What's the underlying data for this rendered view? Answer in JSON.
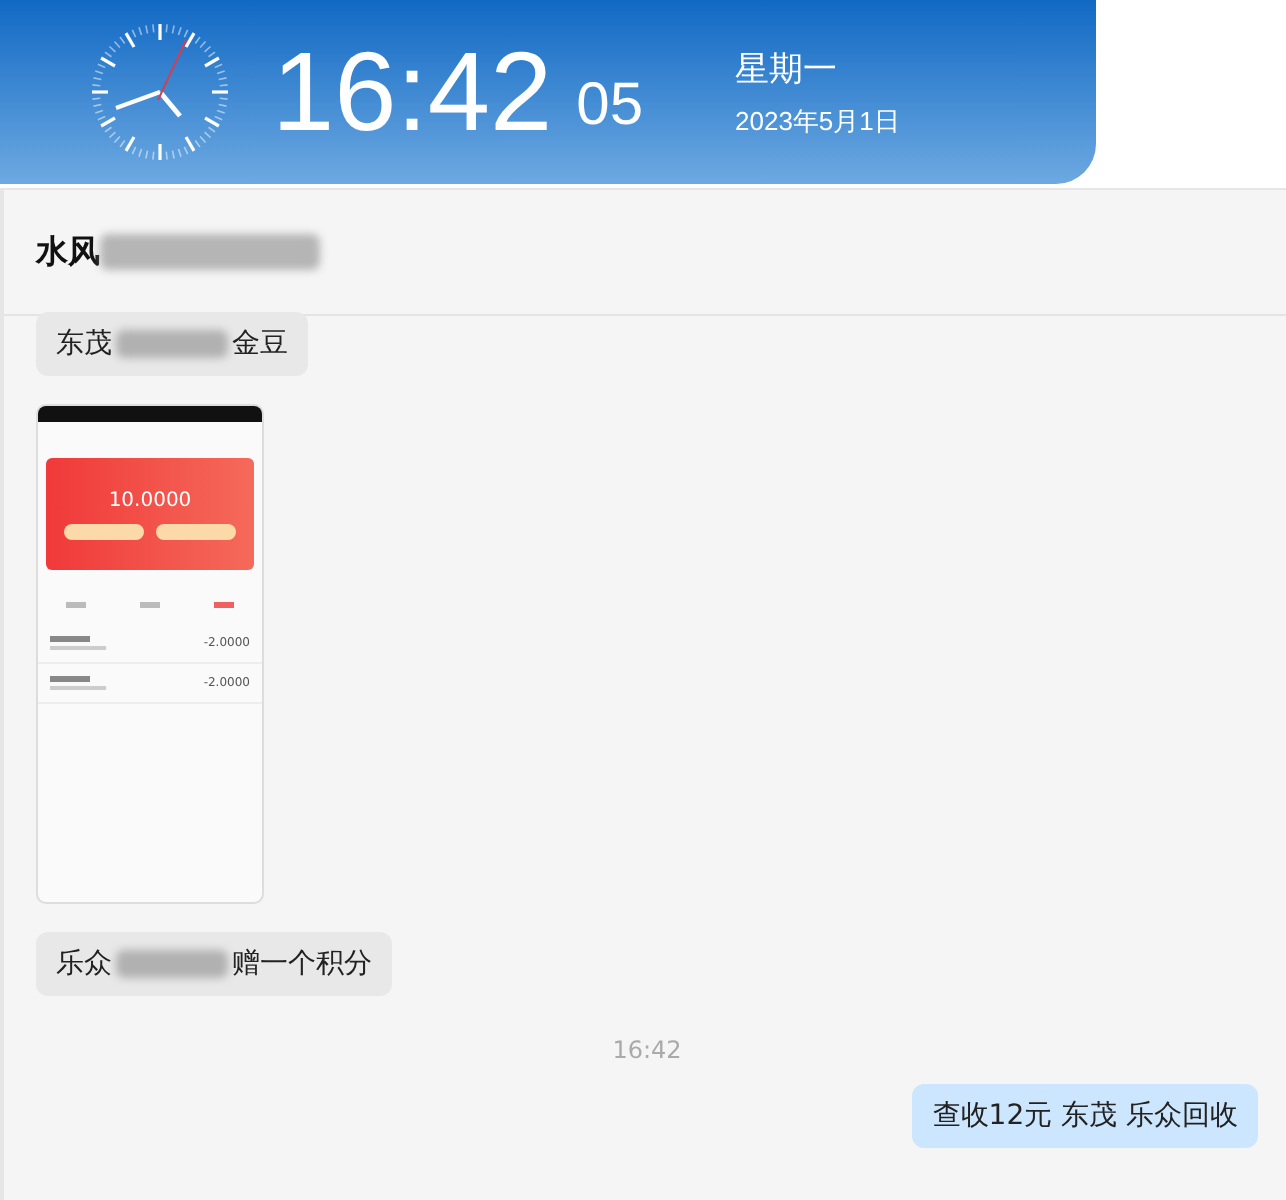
{
  "clock": {
    "time": "16:42",
    "seconds": "05",
    "weekday": "星期一",
    "date": "2023年5月1日"
  },
  "chat": {
    "title": [
      {
        "kind": "text",
        "text": "水风"
      },
      {
        "kind": "blur"
      }
    ],
    "messages": [
      {
        "kind": "received",
        "parts": [
          {
            "kind": "text",
            "text": "东茂"
          },
          {
            "kind": "blur"
          },
          {
            "kind": "text",
            "text": "金豆"
          }
        ]
      },
      {
        "kind": "screenshot",
        "balance": "10.0000",
        "entries": [
          "-2.0000",
          "-2.0000"
        ]
      },
      {
        "kind": "received",
        "parts": [
          {
            "kind": "text",
            "text": "乐众"
          },
          {
            "kind": "blur"
          },
          {
            "kind": "text",
            "text": "赠一个积分"
          }
        ]
      },
      {
        "kind": "time",
        "text": "16:42"
      },
      {
        "kind": "sent",
        "parts": [
          {
            "kind": "text",
            "text": "查收12元   东茂  乐众回收"
          }
        ]
      }
    ]
  }
}
